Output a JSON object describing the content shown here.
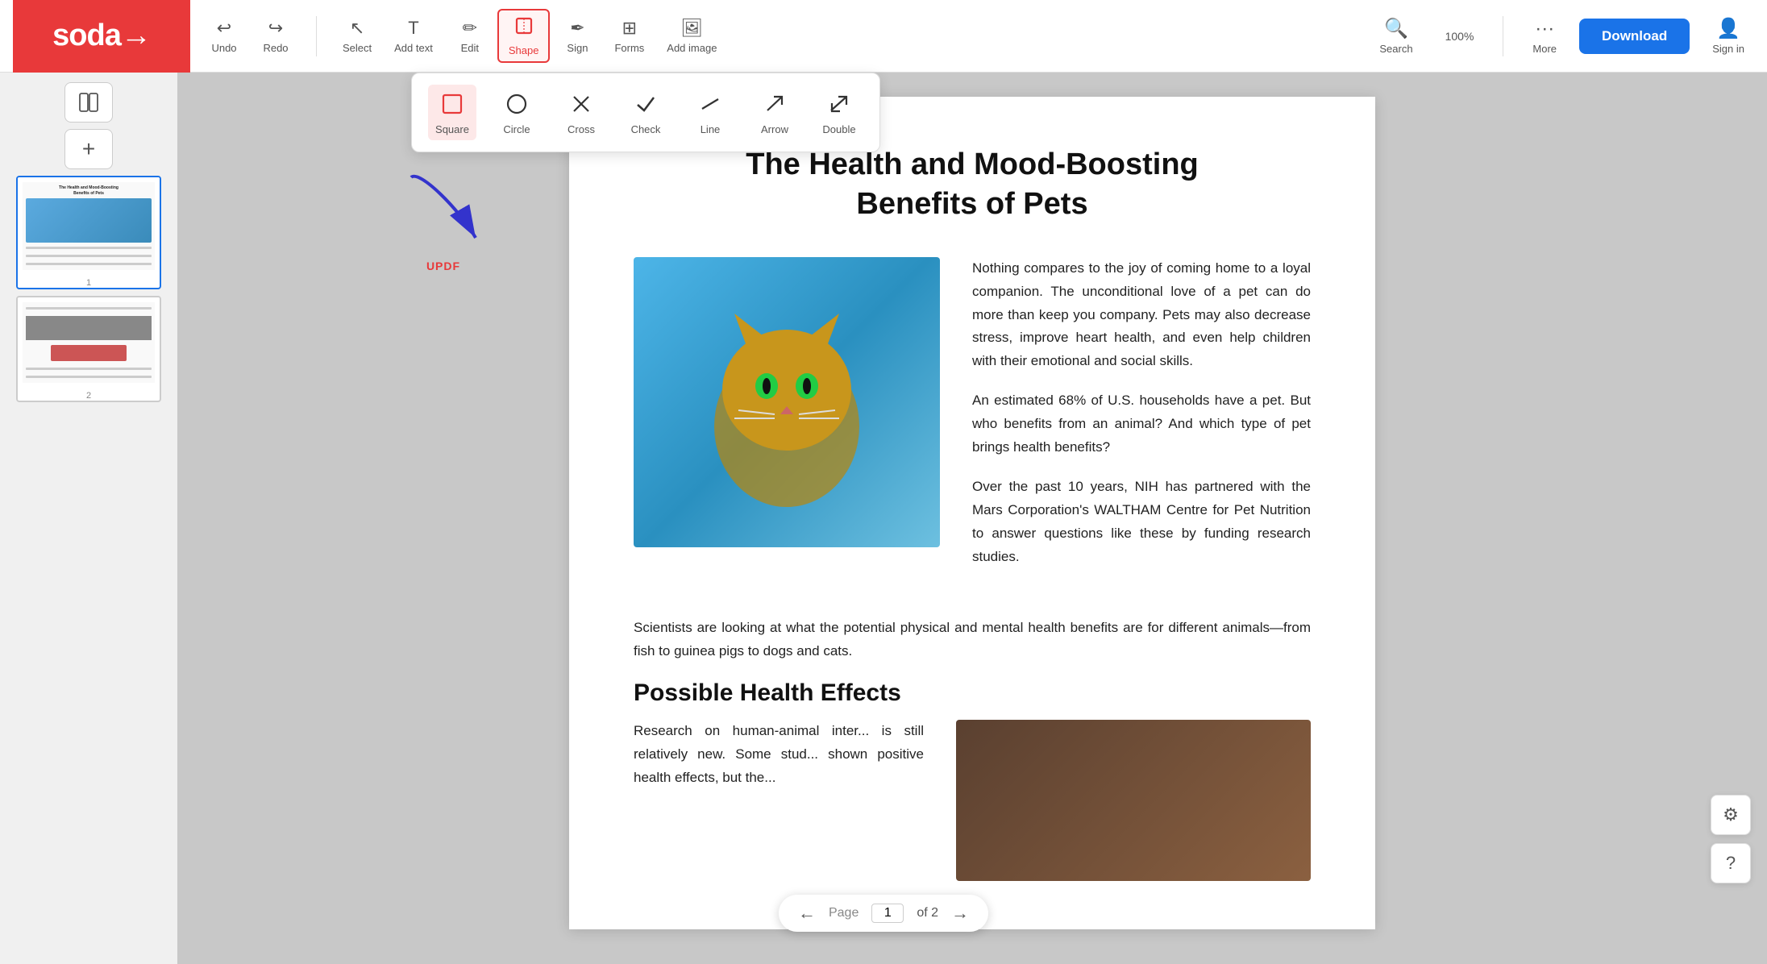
{
  "app": {
    "name": "soda",
    "logo_text": "soda→"
  },
  "toolbar": {
    "undo_label": "Undo",
    "redo_label": "Redo",
    "select_label": "Select",
    "add_text_label": "Add text",
    "edit_label": "Edit",
    "shape_label": "Shape",
    "sign_label": "Sign",
    "forms_label": "Forms",
    "add_image_label": "Add image",
    "search_label": "Search",
    "zoom_label": "100%",
    "more_label": "More",
    "download_label": "Download",
    "signin_label": "Sign in"
  },
  "shape_picker": {
    "shapes": [
      {
        "id": "square",
        "label": "Square",
        "icon": "□"
      },
      {
        "id": "circle",
        "label": "Circle",
        "icon": "○"
      },
      {
        "id": "cross",
        "label": "Cross",
        "icon": "✕"
      },
      {
        "id": "check",
        "label": "Check",
        "icon": "✓"
      },
      {
        "id": "line",
        "label": "Line",
        "icon": "—"
      },
      {
        "id": "arrow",
        "label": "Arrow",
        "icon": "↗"
      },
      {
        "id": "double",
        "label": "Double",
        "icon": "↗↗"
      }
    ]
  },
  "pdf": {
    "title": "The Health and Mood-Boosting\nBenefits of Pets",
    "para1": "Nothing compares to the joy of coming home to a loyal companion. The unconditional love of a pet can do more than keep you company. Pets may also decrease stress, improve heart health, and even help children with their emotional and social skills.",
    "para2": "An estimated 68% of U.S. households have a pet. But who benefits from an animal? And which type of pet brings health benefits?",
    "para3": "Over the past 10 years, NIH has partnered with the Mars Corporation's WALTHAM Centre for Pet Nutrition to answer questions like these by funding research studies.",
    "scientists_para": "Scientists are looking at what the potential physical and mental health benefits are for different animals—from fish to guinea pigs to dogs and cats.",
    "section_heading": "Possible Health Effects",
    "research_para": "Research on human-animal inter... is still relatively new. Some stud... shown positive health effects, but the..."
  },
  "annotation": {
    "updf_label": "UPDF"
  },
  "page_nav": {
    "page_label": "Page",
    "current_page": "1",
    "total_pages": "of 2"
  },
  "sidebar": {
    "page1_num": "1",
    "page2_num": "2",
    "page1_title": "The Health and Mood-Boosting\nBenefits of Pets"
  },
  "right_edge": {
    "settings_label": "Settings",
    "help_label": "Help"
  }
}
